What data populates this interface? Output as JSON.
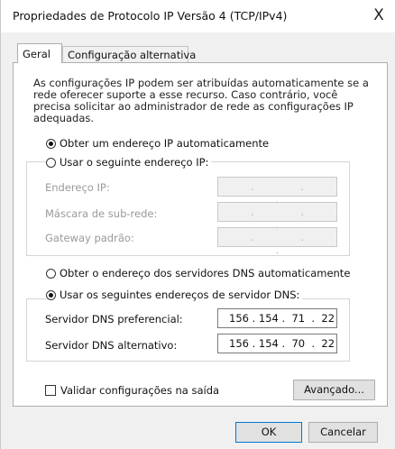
{
  "window": {
    "title": "Propriedades de Protocolo IP Versão 4 (TCP/IPv4)",
    "close_label": "X"
  },
  "tabs": [
    {
      "label": "Geral",
      "active": true
    },
    {
      "label": "Configuração alternativa",
      "active": false
    }
  ],
  "description": "As configurações IP podem ser atribuídas automaticamente se a rede oferecer suporte a esse recurso. Caso contrário, você precisa solicitar ao administrador de rede as configurações IP adequadas.",
  "ip": {
    "auto_label": "Obter um endereço IP automaticamente",
    "auto_selected": true,
    "manual_label": "Usar o seguinte endereço IP:",
    "fields": [
      {
        "label": "Endereço IP:",
        "value": ""
      },
      {
        "label": "Máscara de sub-rede:",
        "value": ""
      },
      {
        "label": "Gateway padrão:",
        "value": ""
      }
    ],
    "empty_dots": ". . ."
  },
  "dns": {
    "auto_label": "Obter o endereço dos servidores DNS automaticamente",
    "manual_label": "Usar os seguintes endereços de servidor DNS:",
    "manual_selected": true,
    "preferred_label": "Servidor DNS preferencial:",
    "preferred_value": "156 . 154 .  71  .  22",
    "alternate_label": "Servidor DNS alternativo:",
    "alternate_value": "156 . 154 .  70  .  22"
  },
  "validate_label": "Validar configurações na saída",
  "validate_checked": false,
  "buttons": {
    "advanced": "Avançado...",
    "ok": "OK",
    "cancel": "Cancelar"
  },
  "colors": {
    "accent": "#0078d7",
    "dialog_bg": "#f0f0f0",
    "panel_bg": "#ffffff"
  }
}
